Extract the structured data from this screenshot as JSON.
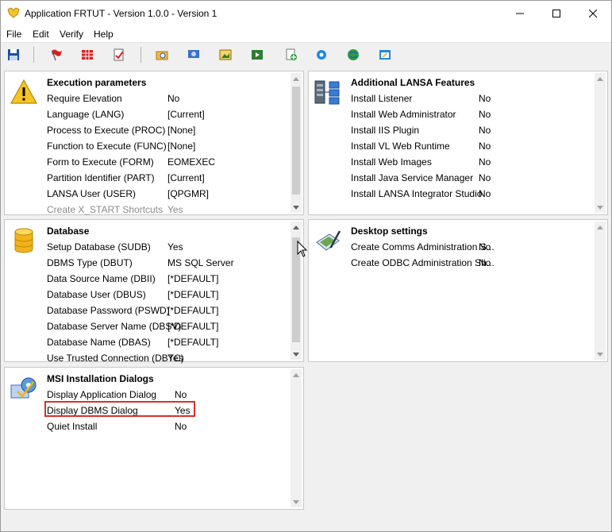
{
  "window": {
    "title": "Application FRTUT - Version 1.0.0 - Version 1"
  },
  "menu": {
    "file": "File",
    "edit": "Edit",
    "verify": "Verify",
    "help": "Help"
  },
  "panels": {
    "execution": {
      "title": "Execution parameters",
      "rows": [
        {
          "label": "Require Elevation",
          "value": "No"
        },
        {
          "label": "Language (LANG)",
          "value": "[Current]"
        },
        {
          "label": "Process to Execute (PROC)",
          "value": "[None]"
        },
        {
          "label": "Function to Execute (FUNC)",
          "value": "[None]"
        },
        {
          "label": "Form to Execute (FORM)",
          "value": "EOMEXEC"
        },
        {
          "label": "Partition Identifier (PART)",
          "value": "[Current]"
        },
        {
          "label": "LANSA User (USER)",
          "value": "[QPGMR]"
        },
        {
          "label": "Create X_START Shortcuts",
          "value": "Yes"
        }
      ]
    },
    "lansa_features": {
      "title": "Additional LANSA Features",
      "rows": [
        {
          "label": "Install Listener",
          "value": "No"
        },
        {
          "label": "Install Web Administrator",
          "value": "No"
        },
        {
          "label": "Install IIS Plugin",
          "value": "No"
        },
        {
          "label": "Install VL Web Runtime",
          "value": "No"
        },
        {
          "label": "Install Web Images",
          "value": "No"
        },
        {
          "label": "Install Java Service Manager",
          "value": "No"
        },
        {
          "label": "Install LANSA Integrator Studio",
          "value": "No"
        }
      ]
    },
    "database": {
      "title": "Database",
      "rows": [
        {
          "label": "Setup Database (SUDB)",
          "value": "Yes"
        },
        {
          "label": "DBMS Type (DBUT)",
          "value": "MS SQL Server"
        },
        {
          "label": "Data Source Name (DBII)",
          "value": "[*DEFAULT]"
        },
        {
          "label": "Database User (DBUS)",
          "value": "[*DEFAULT]"
        },
        {
          "label": "Database Password (PSWD)",
          "value": "[*DEFAULT]"
        },
        {
          "label": "Database Server Name (DBSV)",
          "value": "[*DEFAULT]"
        },
        {
          "label": "Database Name (DBAS)",
          "value": "[*DEFAULT]"
        },
        {
          "label": "Use Trusted Connection (DBTC)",
          "value": "Yes"
        }
      ]
    },
    "desktop": {
      "title": "Desktop settings",
      "rows": [
        {
          "label": "Create Comms Administration S...",
          "value": "No"
        },
        {
          "label": "Create ODBC Administration Sh...",
          "value": "No"
        }
      ]
    },
    "msi": {
      "title": "MSI Installation Dialogs",
      "rows": [
        {
          "label": "Display Application Dialog",
          "value": "No"
        },
        {
          "label": "Display DBMS Dialog",
          "value": "Yes"
        },
        {
          "label": "Quiet Install",
          "value": "No"
        }
      ]
    }
  },
  "colors": {
    "highlight": "#d9302c",
    "panel_border": "#c8c8c8",
    "background": "#f0f0f0"
  }
}
